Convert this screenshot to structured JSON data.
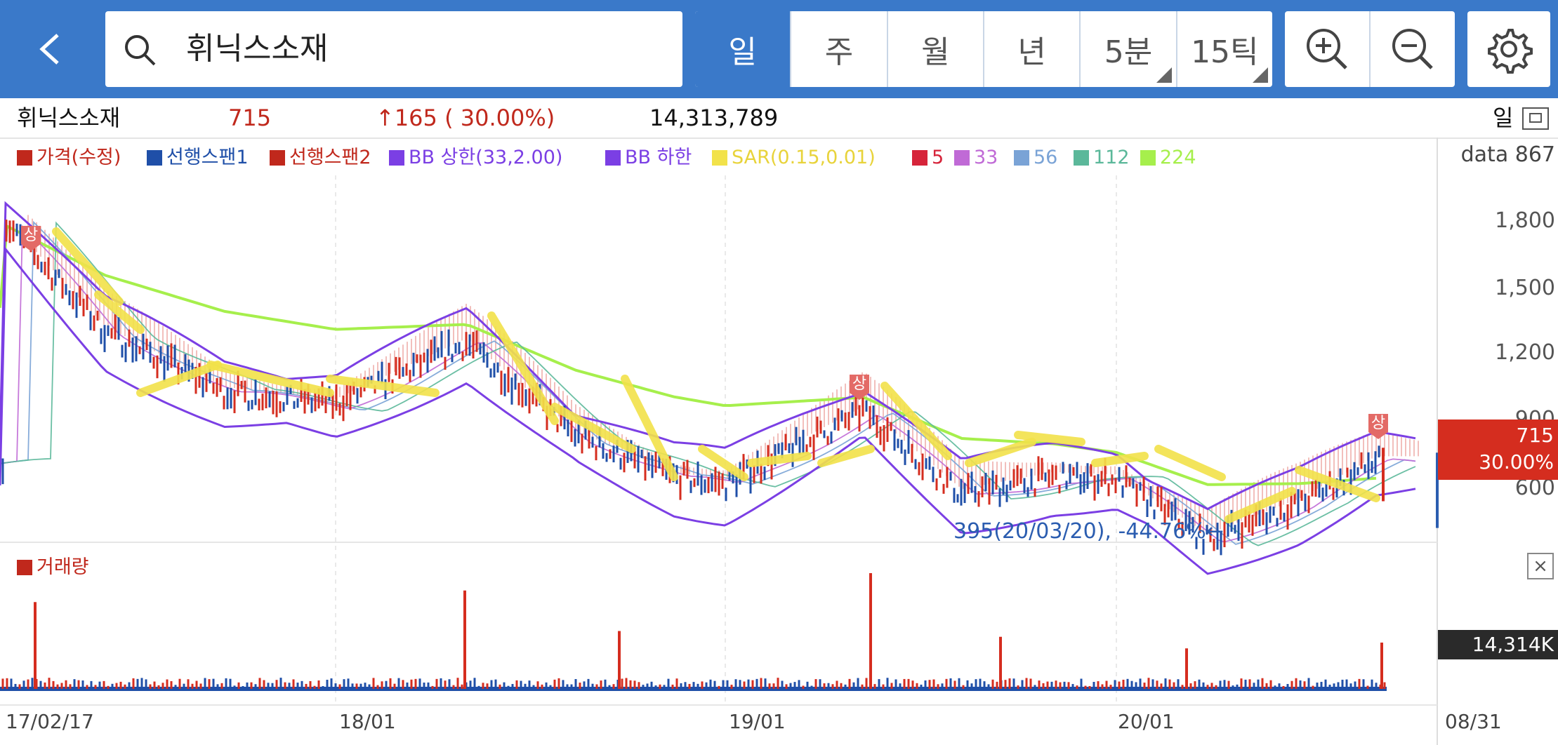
{
  "header": {
    "back_icon": "chevron-left-icon",
    "search_icon": "search-icon",
    "search_value": "휘닉스소재",
    "periods": [
      {
        "label": "일",
        "active": true,
        "has_menu": false
      },
      {
        "label": "주",
        "active": false,
        "has_menu": false
      },
      {
        "label": "월",
        "active": false,
        "has_menu": false
      },
      {
        "label": "년",
        "active": false,
        "has_menu": false
      },
      {
        "label": "5분",
        "active": false,
        "has_menu": true
      },
      {
        "label": "15틱",
        "active": false,
        "has_menu": true
      }
    ],
    "zoom_in_icon": "zoom-in-icon",
    "zoom_out_icon": "zoom-out-icon",
    "settings_icon": "gear-icon"
  },
  "info": {
    "name": "휘닉스소재",
    "price": "715",
    "change": "↑165 ( 30.00%)",
    "volume": "14,313,789",
    "period_label": "일"
  },
  "legend": [
    {
      "label": "가격(수정)",
      "color": "#c0281c"
    },
    {
      "label": "선행스팬1",
      "color": "#1f4fa8"
    },
    {
      "label": "선행스팬2",
      "color": "#c0281c"
    },
    {
      "label": "BB 상한(33,2.00)",
      "color": "#7b3fe4"
    },
    {
      "label": "BB 하한",
      "color": "#7b3fe4"
    },
    {
      "label": "SAR(0.15,0.01)",
      "color": "#f2e24a"
    },
    {
      "label": "5",
      "color": "#d6243a"
    },
    {
      "label": "33",
      "color": "#c06ad6"
    },
    {
      "label": "56",
      "color": "#7aa3d6"
    },
    {
      "label": "112",
      "color": "#5bb89a"
    },
    {
      "label": "224",
      "color": "#a6ef4c"
    }
  ],
  "axis": {
    "data_label": "data 867",
    "y_ticks": [
      "1,800",
      "1,500",
      "1,200",
      "900",
      "600"
    ],
    "price_tag_line1": "715",
    "price_tag_line2": "30.00%",
    "volume_tag": "14,314K",
    "x_ticks": [
      "17/02/17",
      "18/01",
      "19/01",
      "20/01",
      "08/31"
    ]
  },
  "annotation": "395(20/03/20), -44.76%←",
  "limit_up_marker": "상",
  "volume_title": "거래량",
  "volume_close": "×",
  "colors": {
    "header": "#3a79c9",
    "up": "#d52d1f",
    "down": "#1f4fa8",
    "sar": "#f2e24a",
    "ma224": "#a6ef4c",
    "bollinger": "#7b3fe4"
  },
  "chart_data": {
    "type": "line",
    "y_range": [
      400,
      1900
    ],
    "price_trend": [
      {
        "x": "17/02/17",
        "y": 1700
      },
      {
        "x": "17/05",
        "y": 1250
      },
      {
        "x": "17/09",
        "y": 1000
      },
      {
        "x": "18/01",
        "y": 950
      },
      {
        "x": "18/03",
        "y": 1200
      },
      {
        "x": "18/06",
        "y": 820
      },
      {
        "x": "18/10",
        "y": 650
      },
      {
        "x": "19/01",
        "y": 620
      },
      {
        "x": "19/03",
        "y": 920
      },
      {
        "x": "19/06",
        "y": 580
      },
      {
        "x": "19/10",
        "y": 650
      },
      {
        "x": "20/01",
        "y": 640
      },
      {
        "x": "20/03/20",
        "y": 395
      },
      {
        "x": "20/06",
        "y": 540
      },
      {
        "x": "08/31",
        "y": 715
      }
    ],
    "volume_spikes": [
      {
        "x": "17/03",
        "relative": 0.75
      },
      {
        "x": "18/03",
        "relative": 0.85
      },
      {
        "x": "18/08",
        "relative": 0.5
      },
      {
        "x": "19/03",
        "relative": 1.0
      },
      {
        "x": "19/08",
        "relative": 0.45
      },
      {
        "x": "20/02",
        "relative": 0.35
      },
      {
        "x": "08/31",
        "relative": 0.4
      }
    ]
  }
}
